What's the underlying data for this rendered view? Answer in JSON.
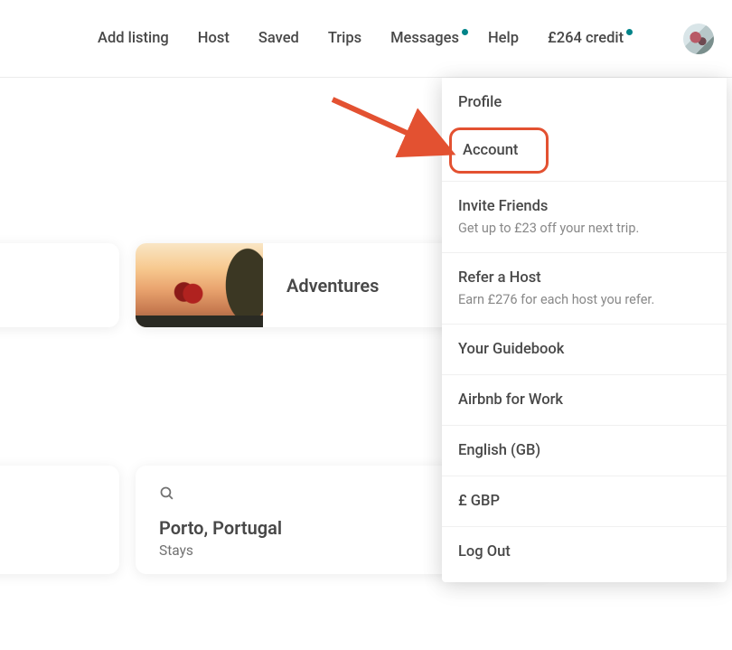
{
  "nav": {
    "add_listing": "Add listing",
    "host": "Host",
    "saved": "Saved",
    "trips": "Trips",
    "messages": "Messages",
    "help": "Help",
    "credit": "£264 credit"
  },
  "cards": {
    "adventures": "Adventures"
  },
  "search": {
    "location": "Porto, Portugal",
    "type": "Stays"
  },
  "menu": {
    "profile": "Profile",
    "account": "Account",
    "invite": {
      "label": "Invite Friends",
      "sub": "Get up to £23 off your next trip."
    },
    "refer": {
      "label": "Refer a Host",
      "sub": "Earn £276 for each host you refer."
    },
    "guidebook": "Your Guidebook",
    "work": "Airbnb for Work",
    "language": "English (GB)",
    "currency": "£ GBP",
    "logout": "Log Out"
  },
  "colors": {
    "accent": "#e35131",
    "teal": "#008489"
  }
}
